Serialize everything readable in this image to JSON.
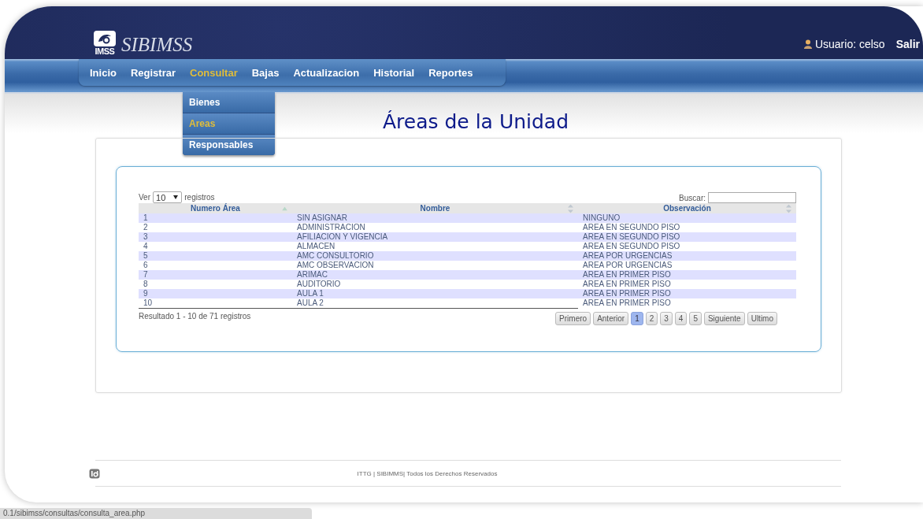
{
  "header": {
    "logo_caption": "IMSS",
    "app_name": "SIBIMSS",
    "user_label": "Usuario: celso",
    "logout": "Salir"
  },
  "nav": [
    {
      "label": "Inicio",
      "selected": false
    },
    {
      "label": "Registrar",
      "selected": false
    },
    {
      "label": "Consultar",
      "selected": true
    },
    {
      "label": "Bajas",
      "selected": false
    },
    {
      "label": "Actualizacion",
      "selected": false
    },
    {
      "label": "Historial",
      "selected": false
    },
    {
      "label": "Reportes",
      "selected": false
    }
  ],
  "submenu": [
    {
      "label": "Bienes",
      "selected": false
    },
    {
      "label": "Areas",
      "selected": true
    },
    {
      "label": "Responsables",
      "selected": false
    }
  ],
  "page_title": "Áreas de la Unidad",
  "table": {
    "length_prefix": "Ver",
    "length_value": "10",
    "length_suffix": "registros",
    "search_label": "Buscar:",
    "columns": [
      {
        "label": "Numero Área",
        "sorted": true
      },
      {
        "label": "Nombre",
        "sorted": false
      },
      {
        "label": "Observación",
        "sorted": false
      }
    ],
    "rows": [
      [
        "1",
        "SIN ASIGNAR",
        "NINGUNO"
      ],
      [
        "2",
        "ADMINISTRACION",
        "AREA EN SEGUNDO PISO"
      ],
      [
        "3",
        "AFILIACION Y VIGENCIA",
        "AREA EN SEGUNDO PISO"
      ],
      [
        "4",
        "ALMACEN",
        "AREA EN SEGUNDO PISO"
      ],
      [
        "5",
        "AMC CONSULTORIO",
        "AREA POR URGENCIAS"
      ],
      [
        "6",
        "AMC OBSERVACION",
        "AREA POR URGENCIAS"
      ],
      [
        "7",
        "ARIMAC",
        "AREA EN PRIMER PISO"
      ],
      [
        "8",
        "AUDITORIO",
        "AREA EN PRIMER PISO"
      ],
      [
        "9",
        "AULA 1",
        "AREA EN PRIMER PISO"
      ],
      [
        "10",
        "AULA 2",
        "AREA EN PRIMER PISO"
      ]
    ],
    "info": "Resultado 1 - 10 de 71 registros",
    "pagination": [
      {
        "label": "Primero",
        "selected": false
      },
      {
        "label": "Anterior",
        "selected": false
      },
      {
        "label": "1",
        "selected": true
      },
      {
        "label": "2",
        "selected": false
      },
      {
        "label": "3",
        "selected": false
      },
      {
        "label": "4",
        "selected": false
      },
      {
        "label": "5",
        "selected": false
      },
      {
        "label": "Siguiente",
        "selected": false
      },
      {
        "label": "Ultimo",
        "selected": false
      }
    ]
  },
  "footer": {
    "text": "ITTG | SIBIMMS| Todos los Derechos Reservados"
  },
  "status_bar": {
    "url": "0.1/sibimss/consultas/consulta_area.php"
  }
}
